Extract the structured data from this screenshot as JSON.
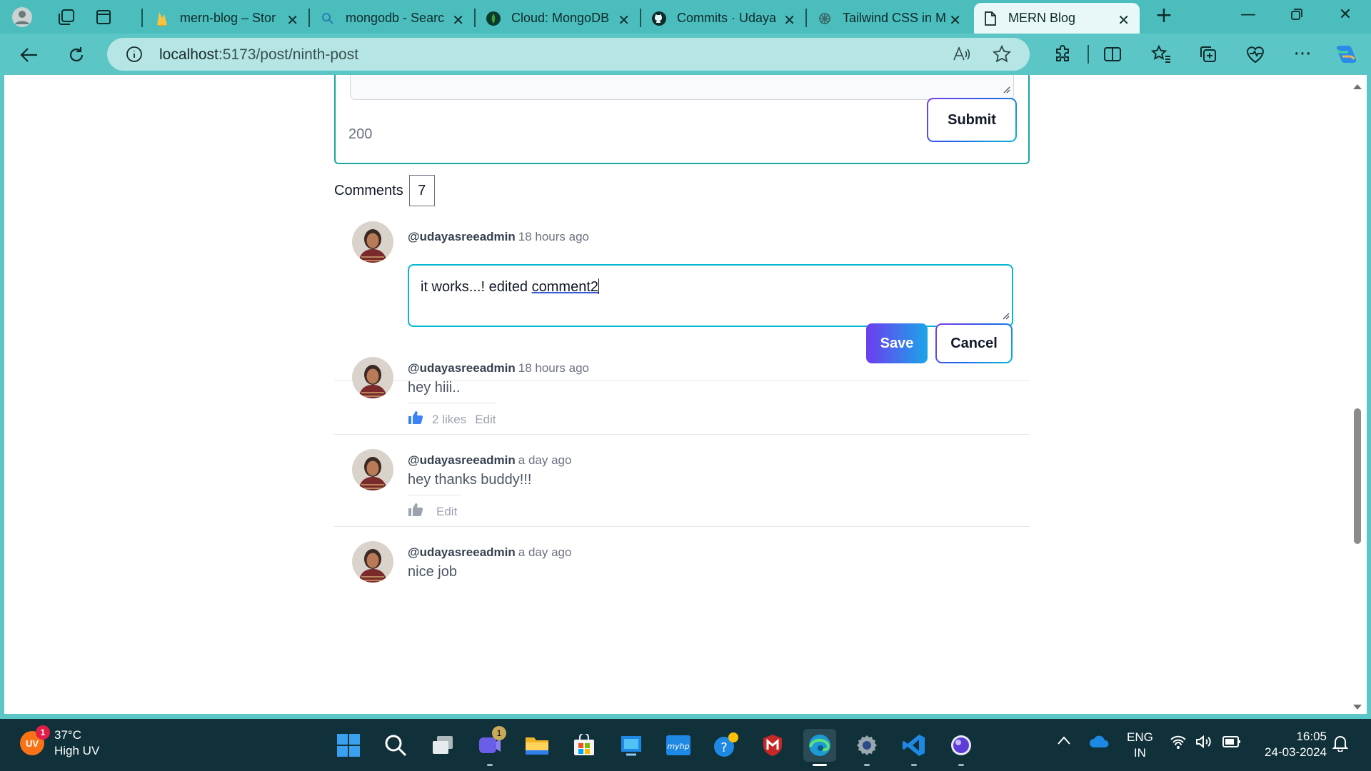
{
  "browser": {
    "tabs": [
      {
        "title": "mern-blog – Stor",
        "favicon": "firebase-icon"
      },
      {
        "title": "mongodb - Searc",
        "favicon": "search-icon"
      },
      {
        "title": "Cloud: MongoDB",
        "favicon": "mongodb-leaf-icon"
      },
      {
        "title": "Commits · Udaya",
        "favicon": "github-icon"
      },
      {
        "title": "Tailwind CSS in M",
        "favicon": "chatgpt-icon"
      },
      {
        "title": "MERN Blog",
        "favicon": "page-icon",
        "active": true
      }
    ],
    "address": {
      "host": "localhost",
      "path": ":5173/post/ninth-post"
    }
  },
  "comment_form": {
    "remaining_chars": "200",
    "submit_label": "Submit"
  },
  "comments_section": {
    "label": "Comments",
    "count": "7"
  },
  "comments": [
    {
      "user": "@udayasreeadmin",
      "time": "18 hours ago",
      "editing": true,
      "edit_text_pre": "it works...! edited ",
      "edit_text_marked": "comment2",
      "save_label": "Save",
      "cancel_label": "Cancel"
    },
    {
      "user": "@udayasreeadmin",
      "time": "18 hours ago",
      "text": "hey hiii..",
      "likes": "2 likes",
      "liked": true,
      "edit_label": "Edit"
    },
    {
      "user": "@udayasreeadmin",
      "time": "a day ago",
      "text": "hey thanks buddy!!!",
      "likes": "",
      "liked": false,
      "edit_label": "Edit"
    },
    {
      "user": "@udayasreeadmin",
      "time": "a day ago",
      "text": "nice job"
    }
  ],
  "taskbar": {
    "weather": {
      "uv_label": "UV",
      "badge": "1",
      "temp": "37°C",
      "desc": "High UV"
    },
    "teams_badge": "1",
    "lang": {
      "line1": "ENG",
      "line2": "IN"
    },
    "clock": {
      "time": "16:05",
      "date": "24-03-2024"
    }
  },
  "colors": {
    "browser_chrome": "#5cc6c6",
    "accent_teal": "#1aa59f",
    "like_blue": "#3b82f6",
    "save_gradient_start": "#6d3cf0",
    "save_gradient_end": "#1ba5e8"
  }
}
